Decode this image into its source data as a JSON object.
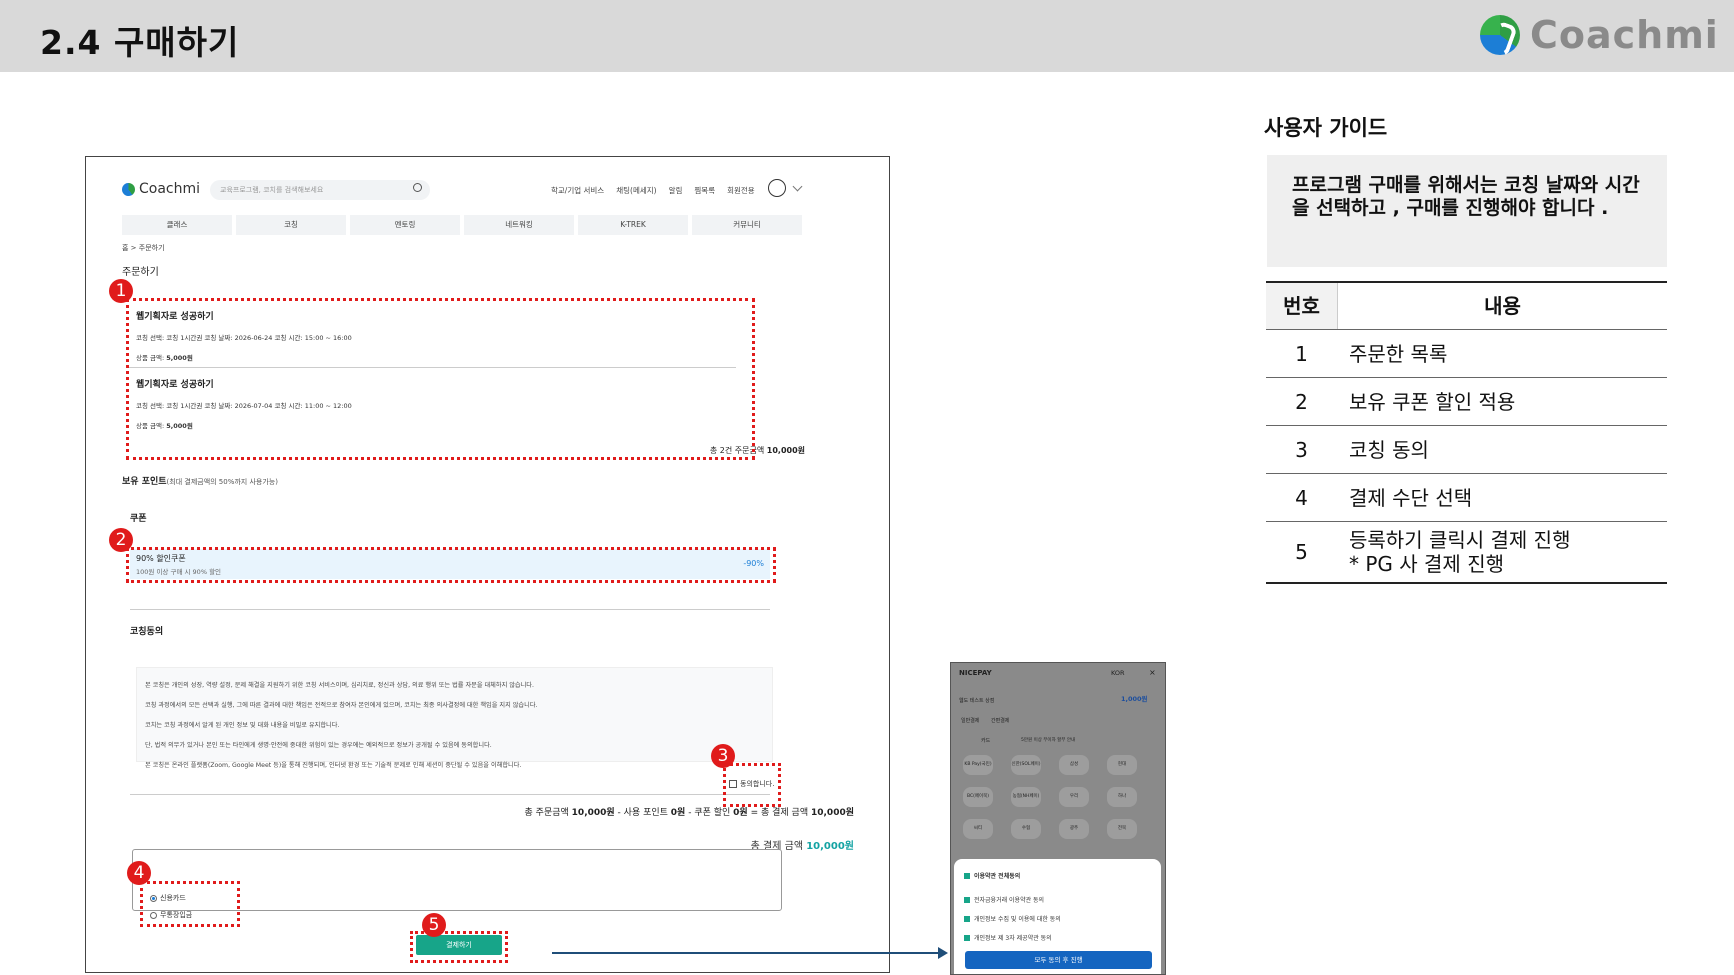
{
  "slide": {
    "title": "2.4  구매하기",
    "brand": "Coachmi"
  },
  "site": {
    "logo": "Coachmi",
    "search_placeholder": "교육프로그램, 코치를 검색해보세요",
    "top_links": [
      "학교/기업 서비스",
      "채팅(메세지)",
      "알림",
      "찜목록",
      "회원전용"
    ],
    "menu": [
      "클래스",
      "코칭",
      "멘토링",
      "네트워킹",
      "K-TREK",
      "커뮤니티"
    ],
    "breadcrumb": "홈 > 주문하기",
    "heading": "주문하기"
  },
  "orders": [
    {
      "title": "웹기획자로 성공하기",
      "meta": "코칭 선택: 코칭 1시간권    코칭 날짜: 2026-06-24    코칭 시간: 15:00 ~ 16:00",
      "price_label": "상품 금액:",
      "price": "5,000원"
    },
    {
      "title": "웹기획자로 성공하기",
      "meta": "코칭 선택: 코칭 1시간권    코칭 날짜: 2026-07-04    코칭 시간: 11:00 ~ 12:00",
      "price_label": "상품 금액:",
      "price": "5,000원"
    }
  ],
  "order_total": {
    "label": "총 2건 주문금액",
    "value": "10,000원"
  },
  "points": {
    "label": "보유 포인트",
    "note": "(최대 결제금액의 50%까지 사용가능)"
  },
  "coupon": {
    "heading": "쿠폰",
    "name": "90% 할인쿠폰",
    "desc": "100원 이상 구매 시 90% 할인",
    "pct": "-90%"
  },
  "agreement": {
    "heading": "코칭동의",
    "lines": [
      "본 코칭은 개인의 성장, 역량 설정, 문제 해결을 지원하기 위한 코칭 서비스이며, 심리치료, 정신과 상담, 의료 행위 또는 법률 자문을 대체하지 않습니다.",
      "코칭 과정에서의 모든 선택과 실행, 그에 따른 결과에 대한 책임은 전적으로 참여자 본인에게 있으며, 코치는 최종 의사결정에 대한 책임을 지지 않습니다.",
      "코치는 코칭 과정에서 알게 된 개인 정보 및 대화 내용을 비밀로 유지합니다.",
      "단, 법적 의무가 있거나 본인 또는 타인에게 생명·안전에 중대한 위험이 있는 경우에는 예외적으로 정보가 공개될 수 있음에 동의합니다.",
      "본 코칭은 온라인 플랫폼(Zoom, Google Meet 등)을 통해 진행되며, 인터넷 환경 또는 기술적 문제로 인해 세션이 중단될 수 있음을 이해합니다."
    ],
    "checkbox": "동의합니다."
  },
  "summary": {
    "text_a": "총 주문금액",
    "val_a": "10,000원",
    "text_b": " - 사용 포인트",
    "val_b": "0원",
    "text_c": " - 쿠폰 할인",
    "val_c": "0원",
    "text_d": " = 총 결제 금액",
    "val_d": "10,000원",
    "final_label": "총 결제 금액",
    "final_value": "10,000원"
  },
  "payment": {
    "options": [
      "신용카드",
      "무통장입금"
    ],
    "button": "결제하기"
  },
  "pg": {
    "brand": "NICEPAY",
    "lang": "KOR",
    "amount": "1,000원",
    "store": "웹도 테스트 상점",
    "tags": [
      "일반결제",
      "간편결제"
    ],
    "card_label": "카드",
    "card_note": "5만원 이상 무이자 할부 안내",
    "keys": [
      "KB Pay(국민)",
      "신한(SOL페이)",
      "삼성",
      "현대",
      "BC(페이북)",
      "농협(NH페이)",
      "우리",
      "하나",
      "씨티",
      "수협",
      "광주",
      "전북"
    ],
    "sheet_title": "이용약관 전체동의",
    "sheet_rows": [
      "전자금융거래 이용약관 동의",
      "개인정보 수집 및 이용에 대한 동의",
      "개인정보 제 3자 제공약관 동의"
    ],
    "sheet_button": "모두 동의 후 진행"
  },
  "badges": [
    "1",
    "2",
    "3",
    "4",
    "5"
  ],
  "guide": {
    "title": "사용자 가이드",
    "desc": "프로그램 구매를 위해서는 코칭 날짜와 시간을 선택하고 , 구매를 진행해야 합니다 .",
    "col_num": "번호",
    "col_content": "내용",
    "rows": [
      {
        "num": "1",
        "text": "주문한 목록"
      },
      {
        "num": "2",
        "text": "보유 쿠폰 할인 적용"
      },
      {
        "num": "3",
        "text": "코칭 동의"
      },
      {
        "num": "4",
        "text": "결제 수단 선택"
      },
      {
        "num": "5",
        "text": "등록하기 클릭시 결제 진행",
        "text2": "* PG 사 결제 진행"
      }
    ]
  },
  "colors": {
    "header_bg": "#d9d9d9",
    "annotation": "#e01b1b",
    "pay_button": "#17a589",
    "accent_teal": "#14a3a3",
    "arrow": "#1f4e79"
  }
}
